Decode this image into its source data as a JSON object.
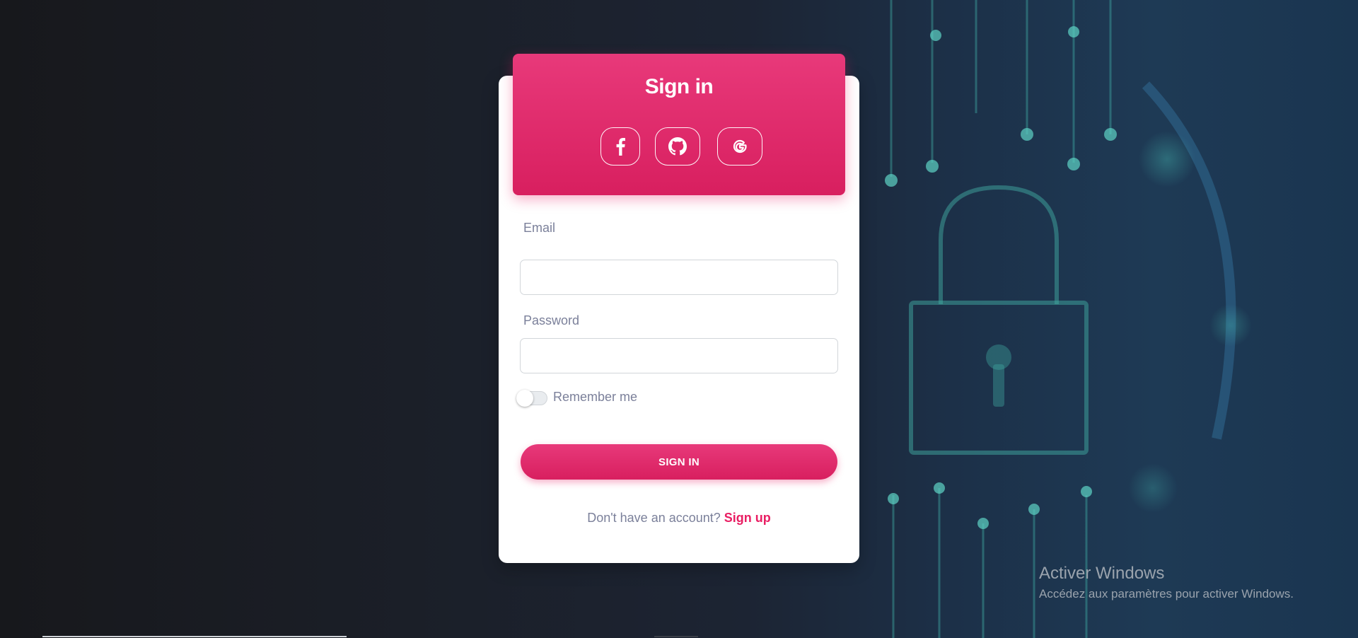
{
  "signin_card": {
    "title": "Sign in",
    "social": [
      {
        "name": "facebook-icon"
      },
      {
        "name": "github-icon"
      },
      {
        "name": "google-icon"
      }
    ],
    "email_label": "Email",
    "email_value": "",
    "password_label": "Password",
    "password_value": "",
    "remember_label": "Remember me",
    "remember_checked": false,
    "submit_label": "SIGN IN",
    "footer_prompt": "Don't have an account?",
    "footer_link": "Sign up"
  },
  "windows_watermark": {
    "title": "Activer Windows",
    "subtitle": "Accédez aux paramètres pour activer Windows."
  },
  "colors": {
    "accent": "#e91e63",
    "text_muted": "#7b809a",
    "card_bg": "#ffffff"
  }
}
